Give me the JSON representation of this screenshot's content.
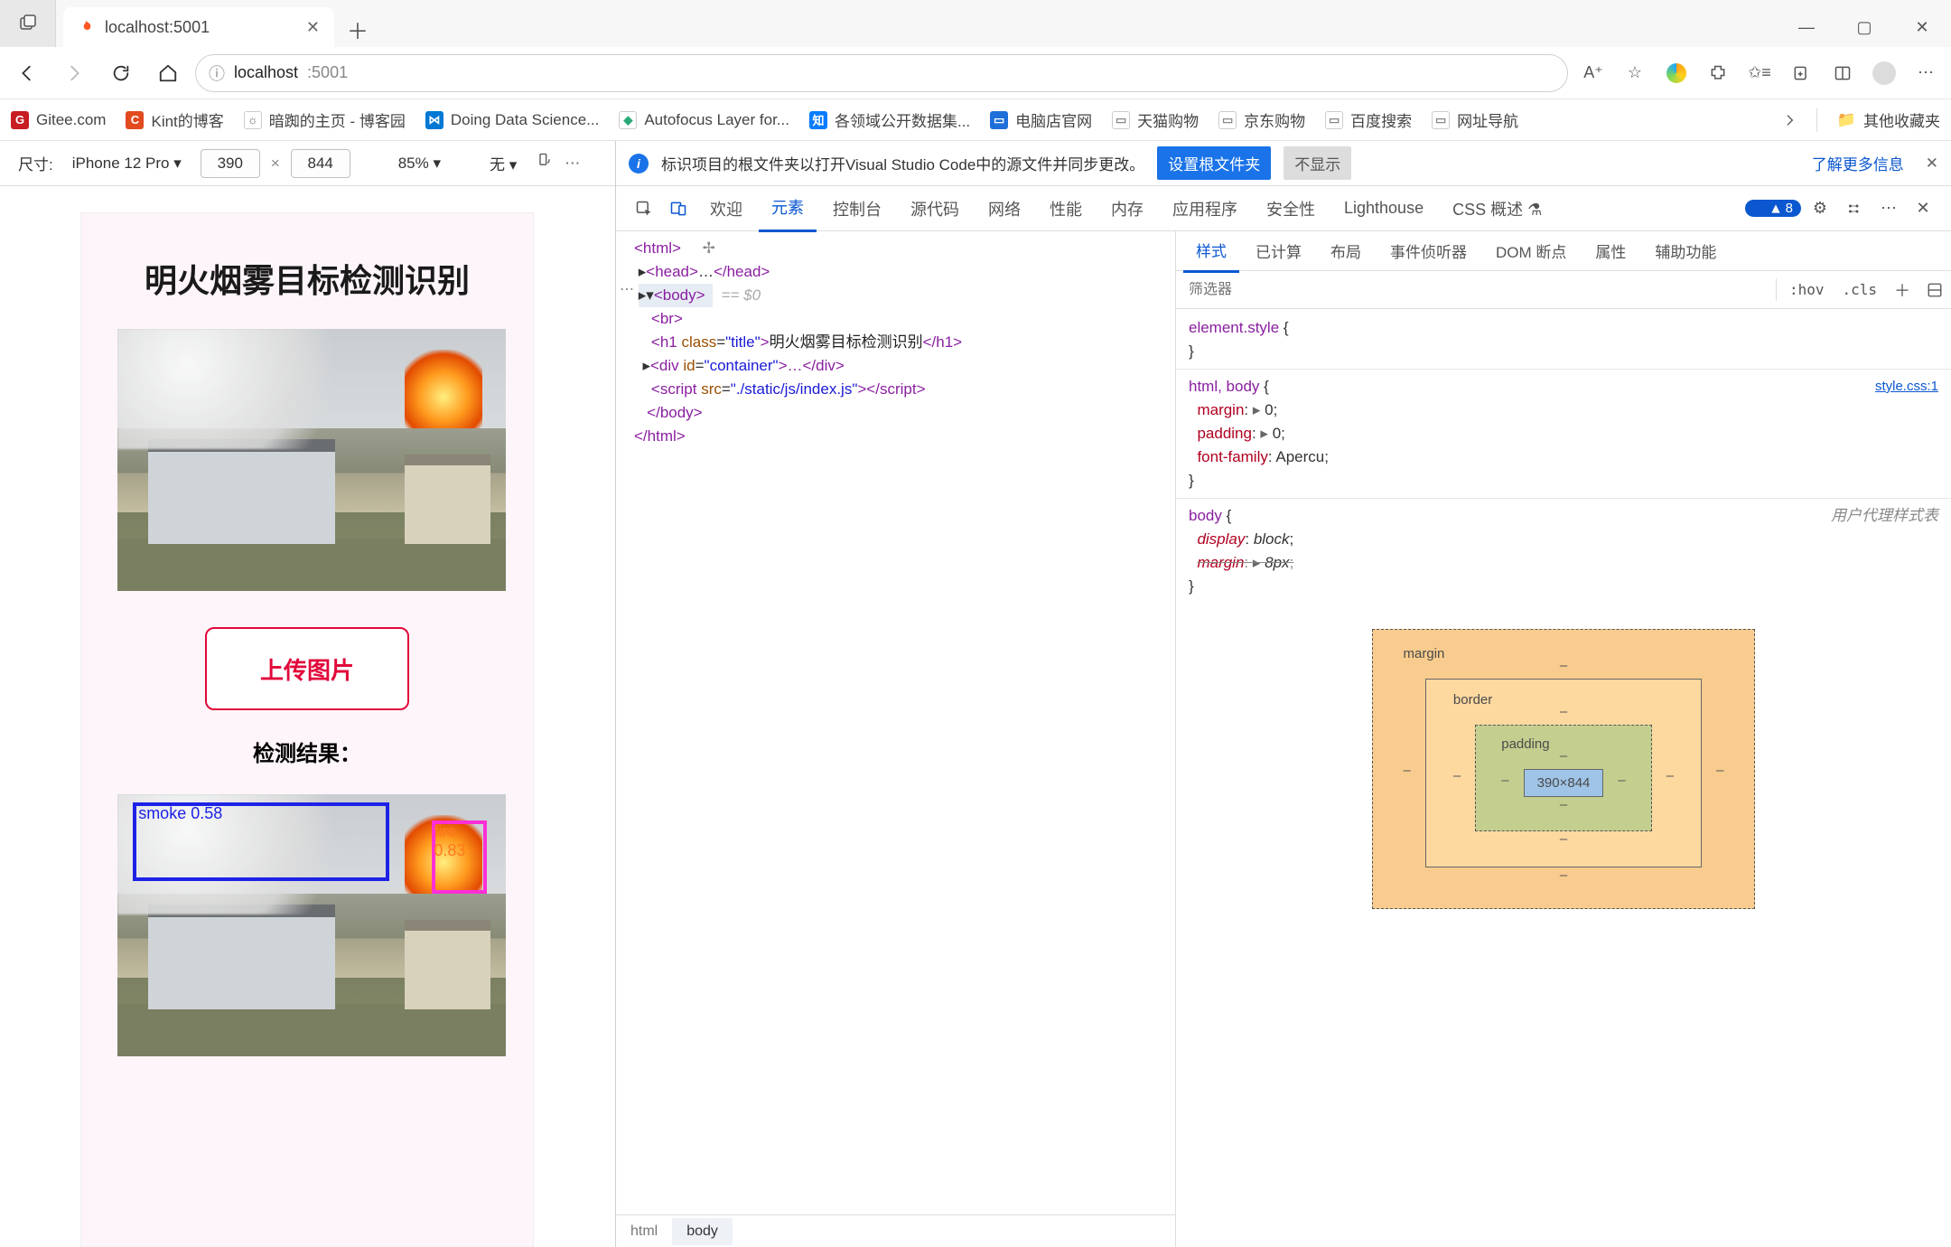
{
  "browser": {
    "tab_title": "localhost:5001",
    "url_host": "localhost",
    "url_path": ":5001",
    "bookmarks": [
      {
        "label": "Gitee.com",
        "icon_bg": "#c71d23",
        "icon_txt": "G"
      },
      {
        "label": "Kint的博客",
        "icon_bg": "#e24a20",
        "icon_txt": "C"
      },
      {
        "label": "暗踟的主页 - 博客园",
        "icon_bg": "#fff",
        "icon_txt": "☼"
      },
      {
        "label": "Doing Data Science...",
        "icon_bg": "#0078d4",
        "icon_txt": "⋈"
      },
      {
        "label": "Autofocus Layer for...",
        "icon_bg": "#fff",
        "icon_txt": "•"
      },
      {
        "label": "各领域公开数据集...",
        "icon_bg": "#0a7cff",
        "icon_txt": "知"
      },
      {
        "label": "电脑店官网",
        "icon_bg": "#1e6fd9",
        "icon_txt": "▭"
      },
      {
        "label": "天猫购物",
        "icon_bg": "#fff",
        "icon_txt": "▭"
      },
      {
        "label": "京东购物",
        "icon_bg": "#fff",
        "icon_txt": "▭"
      },
      {
        "label": "百度搜索",
        "icon_bg": "#fff",
        "icon_txt": "▭"
      },
      {
        "label": "网址导航",
        "icon_bg": "#fff",
        "icon_txt": "▭"
      }
    ],
    "fav_folder": "其他收藏夹"
  },
  "device_bar": {
    "size_label": "尺寸:",
    "device": "iPhone 12 Pro",
    "w": "390",
    "h": "844",
    "zoom": "85%",
    "throttle": "无"
  },
  "app": {
    "title": "明火烟雾目标检测识别",
    "upload": "上传图片",
    "result_label": "检测结果：",
    "det": [
      {
        "cls": "smoke",
        "text": "smoke 0.58"
      },
      {
        "cls": "fire",
        "text": "fire 0.83"
      }
    ]
  },
  "devtools": {
    "info_msg": "标识项目的根文件夹以打开Visual Studio Code中的源文件并同步更改。",
    "btn_set": "设置根文件夹",
    "btn_hide": "不显示",
    "more_info": "了解更多信息",
    "tabs": [
      "欢迎",
      "元素",
      "控制台",
      "源代码",
      "网络",
      "性能",
      "内存",
      "应用程序",
      "安全性",
      "Lighthouse",
      "CSS 概述"
    ],
    "active_tab": "元素",
    "issue_count": "8",
    "sub_tabs": [
      "样式",
      "已计算",
      "布局",
      "事件侦听器",
      "DOM 断点",
      "属性",
      "辅助功能"
    ],
    "active_sub": "样式",
    "filter_placeholder": "筛选器",
    "hov": ":hov",
    "cls": ".cls",
    "crumbs": [
      "html",
      "body"
    ],
    "dom": {
      "l0": "<html>",
      "l1a": "<head>",
      "l1b": "…",
      "l1c": "</head>",
      "l2": "<body>",
      "l2eq": "== $0",
      "l3": "<br>",
      "l4_open": "<h1 ",
      "l4_attr": "class",
      "l4_eq": "=",
      "l4_val": "\"title\"",
      "l4_close": ">",
      "l4_txt": "明火烟雾目标检测识别",
      "l4_end": "</h1>",
      "l5_open": "<div ",
      "l5_attr": "id",
      "l5_val": "\"container\"",
      "l5_mid": ">…",
      "l5_end": "</div>",
      "l6_open": "<script ",
      "l6_attr": "src",
      "l6_val": "\"./static/js/index.js\"",
      "l6_mid": ">",
      "l6_end1": "</",
      "l6_end2": "script>",
      "l7": "</body>",
      "l8": "</html>"
    },
    "styles": {
      "elstyle": "element.style",
      "rule1_sel": "html, body",
      "rule1_src": "style.css:1",
      "rule1_props": [
        {
          "p": "margin",
          "v": "0",
          "tri": true
        },
        {
          "p": "padding",
          "v": "0",
          "tri": true
        },
        {
          "p": "font-family",
          "v": "Apercu",
          "tri": false
        }
      ],
      "rule2_sel": "body",
      "rule2_ua": "用户代理样式表",
      "rule2_props": [
        {
          "p": "display",
          "v": "block",
          "tri": false,
          "strike": false
        },
        {
          "p": "margin",
          "v": "8px",
          "tri": true,
          "strike": true
        }
      ]
    },
    "box": {
      "margin": "margin",
      "border": "border",
      "padding": "padding",
      "content": "390×844",
      "dash": "–"
    }
  }
}
